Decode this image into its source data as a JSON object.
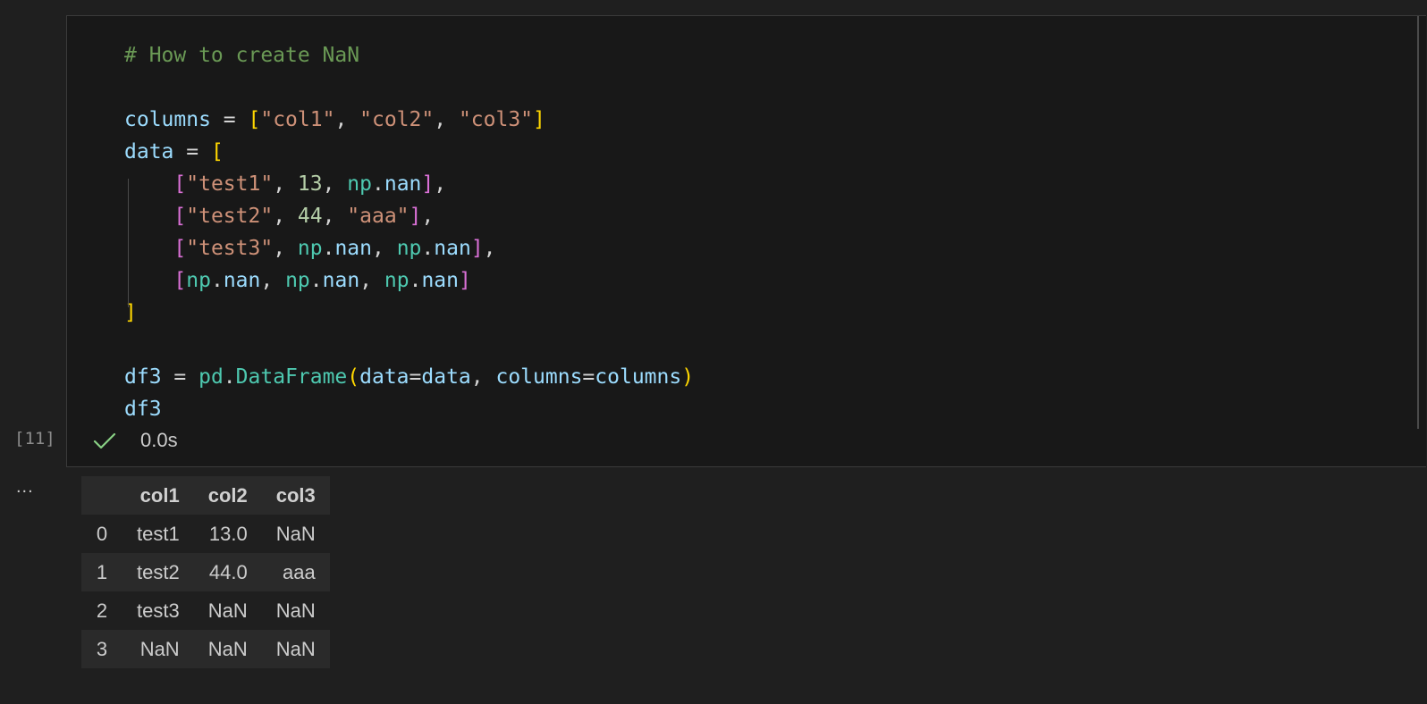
{
  "cell": {
    "execution_count": "[11]",
    "status_time": "0.0s",
    "code_lines": [
      [
        {
          "t": "# How to create NaN",
          "c": "t-comment"
        }
      ],
      [],
      [
        {
          "t": "columns",
          "c": "t-var"
        },
        {
          "t": " = ",
          "c": "t-op"
        },
        {
          "t": "[",
          "c": "t-b1"
        },
        {
          "t": "\"col1\"",
          "c": "t-str"
        },
        {
          "t": ", ",
          "c": "t-op"
        },
        {
          "t": "\"col2\"",
          "c": "t-str"
        },
        {
          "t": ", ",
          "c": "t-op"
        },
        {
          "t": "\"col3\"",
          "c": "t-str"
        },
        {
          "t": "]",
          "c": "t-b1"
        }
      ],
      [
        {
          "t": "data",
          "c": "t-var"
        },
        {
          "t": " = ",
          "c": "t-op"
        },
        {
          "t": "[",
          "c": "t-b1"
        }
      ],
      [
        {
          "t": "    ",
          "c": "t-op"
        },
        {
          "t": "[",
          "c": "t-b2"
        },
        {
          "t": "\"test1\"",
          "c": "t-str"
        },
        {
          "t": ", ",
          "c": "t-op"
        },
        {
          "t": "13",
          "c": "t-num"
        },
        {
          "t": ", ",
          "c": "t-op"
        },
        {
          "t": "np",
          "c": "t-fn"
        },
        {
          "t": ".",
          "c": "t-op"
        },
        {
          "t": "nan",
          "c": "t-var"
        },
        {
          "t": "]",
          "c": "t-b2"
        },
        {
          "t": ",",
          "c": "t-op"
        }
      ],
      [
        {
          "t": "    ",
          "c": "t-op"
        },
        {
          "t": "[",
          "c": "t-b2"
        },
        {
          "t": "\"test2\"",
          "c": "t-str"
        },
        {
          "t": ", ",
          "c": "t-op"
        },
        {
          "t": "44",
          "c": "t-num"
        },
        {
          "t": ", ",
          "c": "t-op"
        },
        {
          "t": "\"aaa\"",
          "c": "t-str"
        },
        {
          "t": "]",
          "c": "t-b2"
        },
        {
          "t": ",",
          "c": "t-op"
        }
      ],
      [
        {
          "t": "    ",
          "c": "t-op"
        },
        {
          "t": "[",
          "c": "t-b2"
        },
        {
          "t": "\"test3\"",
          "c": "t-str"
        },
        {
          "t": ", ",
          "c": "t-op"
        },
        {
          "t": "np",
          "c": "t-fn"
        },
        {
          "t": ".",
          "c": "t-op"
        },
        {
          "t": "nan",
          "c": "t-var"
        },
        {
          "t": ", ",
          "c": "t-op"
        },
        {
          "t": "np",
          "c": "t-fn"
        },
        {
          "t": ".",
          "c": "t-op"
        },
        {
          "t": "nan",
          "c": "t-var"
        },
        {
          "t": "]",
          "c": "t-b2"
        },
        {
          "t": ",",
          "c": "t-op"
        }
      ],
      [
        {
          "t": "    ",
          "c": "t-op"
        },
        {
          "t": "[",
          "c": "t-b2"
        },
        {
          "t": "np",
          "c": "t-fn"
        },
        {
          "t": ".",
          "c": "t-op"
        },
        {
          "t": "nan",
          "c": "t-var"
        },
        {
          "t": ", ",
          "c": "t-op"
        },
        {
          "t": "np",
          "c": "t-fn"
        },
        {
          "t": ".",
          "c": "t-op"
        },
        {
          "t": "nan",
          "c": "t-var"
        },
        {
          "t": ", ",
          "c": "t-op"
        },
        {
          "t": "np",
          "c": "t-fn"
        },
        {
          "t": ".",
          "c": "t-op"
        },
        {
          "t": "nan",
          "c": "t-var"
        },
        {
          "t": "]",
          "c": "t-b2"
        }
      ],
      [
        {
          "t": "]",
          "c": "t-b1"
        }
      ],
      [],
      [
        {
          "t": "df3",
          "c": "t-var"
        },
        {
          "t": " = ",
          "c": "t-op"
        },
        {
          "t": "pd",
          "c": "t-fn"
        },
        {
          "t": ".",
          "c": "t-op"
        },
        {
          "t": "DataFrame",
          "c": "t-fn"
        },
        {
          "t": "(",
          "c": "t-b1"
        },
        {
          "t": "data",
          "c": "t-var"
        },
        {
          "t": "=",
          "c": "t-op"
        },
        {
          "t": "data",
          "c": "t-var"
        },
        {
          "t": ", ",
          "c": "t-op"
        },
        {
          "t": "columns",
          "c": "t-var"
        },
        {
          "t": "=",
          "c": "t-op"
        },
        {
          "t": "columns",
          "c": "t-var"
        },
        {
          "t": ")",
          "c": "t-b1"
        }
      ],
      [
        {
          "t": "df3",
          "c": "t-var"
        }
      ]
    ]
  },
  "output": {
    "more_label": "...",
    "table": {
      "columns": [
        "col1",
        "col2",
        "col3"
      ],
      "rows": [
        {
          "index": "0",
          "cells": [
            "test1",
            "13.0",
            "NaN"
          ]
        },
        {
          "index": "1",
          "cells": [
            "test2",
            "44.0",
            "aaa"
          ]
        },
        {
          "index": "2",
          "cells": [
            "test3",
            "NaN",
            "NaN"
          ]
        },
        {
          "index": "3",
          "cells": [
            "NaN",
            "NaN",
            "NaN"
          ]
        }
      ]
    }
  },
  "colors": {
    "background": "#1f1f1f",
    "cell_background": "#181818",
    "success_check": "#89d185"
  },
  "icons": {
    "status": "check-icon"
  }
}
